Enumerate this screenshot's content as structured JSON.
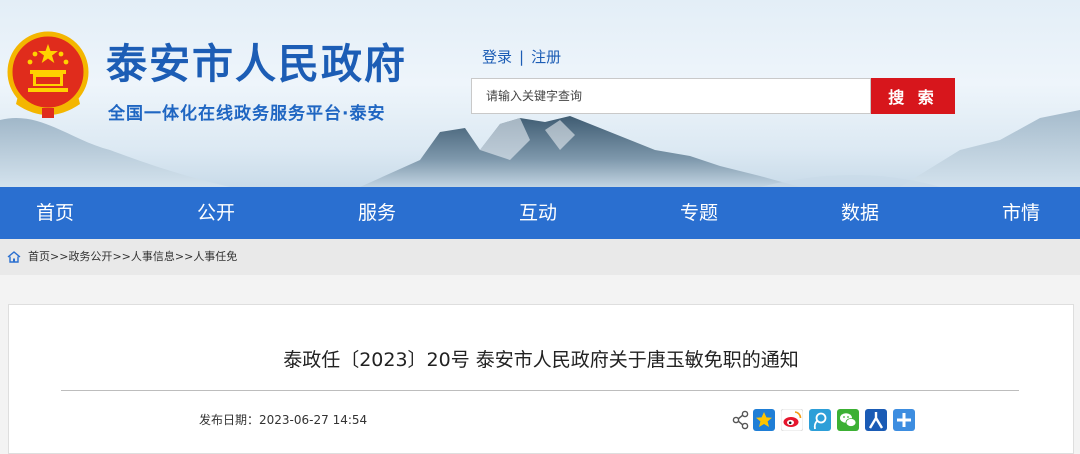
{
  "header": {
    "site_title": "泰安市人民政府",
    "site_subtitle": "全国一体化在线政务服务平台·泰安",
    "login_label": "登录",
    "separator": "|",
    "register_label": "注册",
    "search_placeholder": "请输入关键字查询",
    "search_button": "搜 索"
  },
  "nav": {
    "items": [
      {
        "label": "首页"
      },
      {
        "label": "公开"
      },
      {
        "label": "服务"
      },
      {
        "label": "互动"
      },
      {
        "label": "专题"
      },
      {
        "label": "数据"
      },
      {
        "label": "市情"
      }
    ]
  },
  "breadcrumb": {
    "items": [
      "首页",
      "政务公开",
      "人事信息",
      "人事任免"
    ],
    "separator": ">>"
  },
  "article": {
    "title": "泰政任〔2023〕20号 泰安市人民政府关于唐玉敏免职的通知",
    "date_label": "发布日期：",
    "date": "2023-06-27 14:54"
  },
  "share": {
    "icons": [
      "share-icon",
      "qzone-icon",
      "weibo-icon",
      "tencent-weibo-icon",
      "wechat-icon",
      "renren-icon",
      "more-share-icon"
    ]
  },
  "colors": {
    "brand_blue": "#1c5db5",
    "nav_blue": "#2a6fd0",
    "search_red": "#d7161c"
  }
}
